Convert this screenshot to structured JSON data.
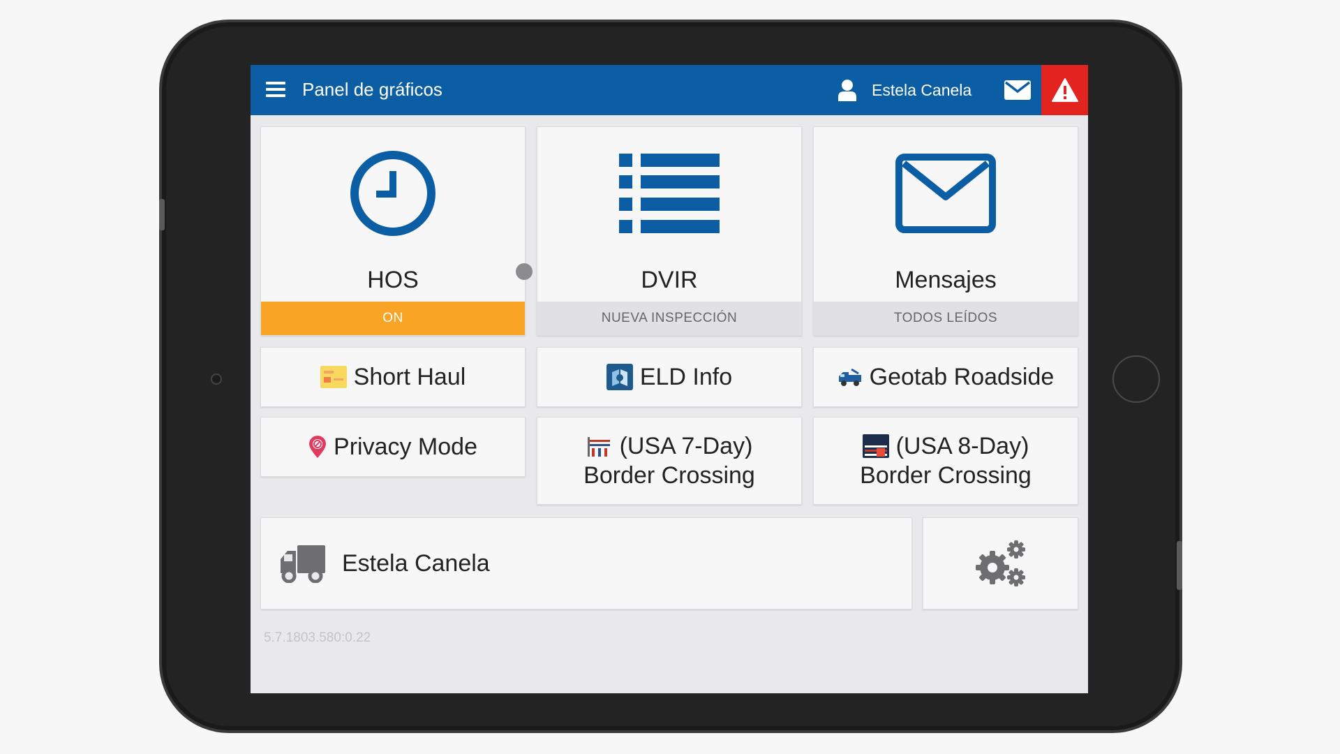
{
  "header": {
    "title": "Panel de gráficos",
    "user_name": "Estela Canela",
    "colors": {
      "bar": "#0b5da4",
      "alert": "#e3231f"
    }
  },
  "tiles": {
    "hos": {
      "label": "HOS",
      "status": "ON",
      "status_color": "#f9a425",
      "icon": "clock-icon"
    },
    "dvir": {
      "label": "DVIR",
      "status": "NUEVA INSPECCIÓN",
      "icon": "list-icon"
    },
    "messages": {
      "label": "Mensajes",
      "status": "TODOS LEÍDOS",
      "icon": "envelope-icon"
    }
  },
  "add_ins": {
    "short_haul": {
      "label": "Short Haul",
      "icon": "card-icon"
    },
    "eld_info": {
      "label": "ELD Info",
      "icon": "eld-book-icon"
    },
    "geotab_roadside": {
      "label": "Geotab Roadside",
      "icon": "roadside-truck-icon"
    },
    "privacy_mode": {
      "label": "Privacy Mode",
      "icon": "location-pin-icon"
    },
    "usa_7_day": {
      "line1": "(USA 7-Day)",
      "line2": "Border Crossing",
      "icon": "border-gate-icon"
    },
    "usa_8_day": {
      "line1": "(USA 8-Day)",
      "line2": "Border Crossing",
      "icon": "us-flag-icon"
    }
  },
  "vehicle": {
    "driver": "Estela Canela",
    "icon": "truck-icon"
  },
  "settings": {
    "icon": "gears-icon"
  },
  "version": "5.7.1803.580:0.22"
}
